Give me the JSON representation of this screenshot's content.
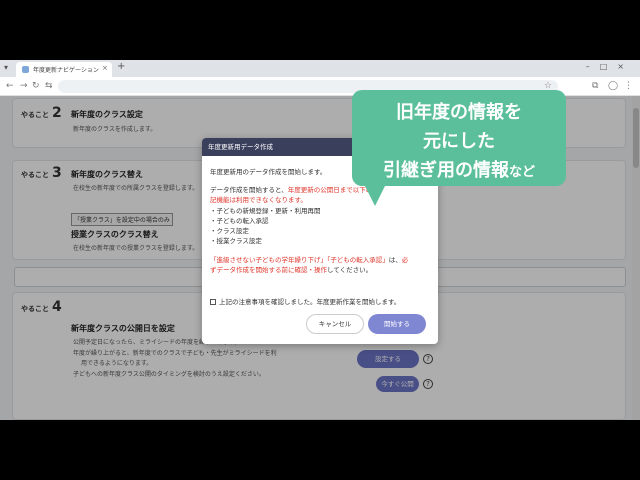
{
  "browser": {
    "tab_title": "年度更新ナビゲーション",
    "menu_glyph": "▾",
    "tab_close_glyph": "×",
    "new_tab_glyph": "+",
    "window_controls": "–□×",
    "back_glyph": "←",
    "forward_glyph": "→",
    "reload_glyph": "↻",
    "settings_glyph": "⇆",
    "star_glyph": "☆",
    "extension_glyph": "⧉",
    "profile_glyph": "◯",
    "menu_more_glyph": "⋮"
  },
  "steps": [
    {
      "label": "やること",
      "num": "2",
      "heading": "新年度のクラス設定",
      "bullet": "新年度のクラスを作成します。"
    },
    {
      "label": "やること",
      "num": "3",
      "heading": "新年度のクラス替え",
      "bullet": "在校生の新年度での所属クラスを登録します。",
      "badge": "「授業クラス」を設定中の場合のみ",
      "sub_heading": "授業クラスのクラス替え",
      "sub_bullet": "在校生の新年度での授業クラスを登録します。"
    },
    {
      "label": "やること",
      "num": "4",
      "heading": "新年度クラスの公開日を設定",
      "bullets": [
        "公開予定日になったら、ミライシードの年度を繰り上げます。",
        "年度が繰り上がると、新年度でのクラスで子ども・先生がミライシードを利",
        "用できるようになります。",
        "子どもへの新年度クラス公開のタイミングを検討のうえ設定ください。"
      ]
    }
  ],
  "buttons": {
    "setting": "設定する",
    "publish": "今すぐ公開",
    "help": "?"
  },
  "modal": {
    "title": "年度更新用データ作成",
    "intro": "年度更新用のデータ作成を開始します。",
    "warn_a": "データ作成を開始すると、",
    "warn_red_1": "年度更新の公開日まで以下の",
    "warn_red_2": "記機能は利用できなくなります。",
    "items": [
      "・子どもの新規登録・更新・利用再開",
      "・子どもの転入承認",
      "・クラス設定",
      "・授業クラス設定"
    ],
    "note_red_1": "「進級させない子どもの学年繰り下げ」「子どもの転入承認」",
    "note_mid": "は、",
    "note_red_2": "必",
    "note_line2_red": "ずデータ作成を開始する前に確認・操作",
    "note_line2": "してください。",
    "confirm": "上記の注意事項を確認しました。年度更新作業を開始します。",
    "cancel": "キャンセル",
    "start": "開始する"
  },
  "callout": {
    "line1": "旧年度の情報を",
    "line2": "元にした",
    "line3": "引継ぎ用の情報",
    "line3_small": "など"
  }
}
